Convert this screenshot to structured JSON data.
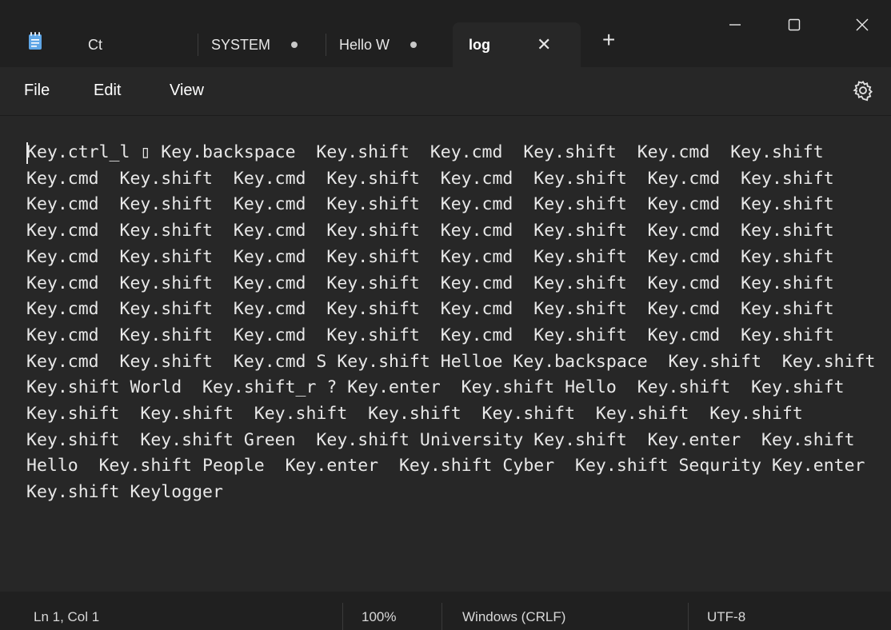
{
  "tabs": [
    {
      "label": "Ct",
      "modified": false,
      "active": false
    },
    {
      "label": "SYSTEM",
      "modified": true,
      "active": false
    },
    {
      "label": "Hello W",
      "modified": true,
      "active": false
    },
    {
      "label": "log",
      "modified": false,
      "active": true
    }
  ],
  "tab_close_glyph": "✕",
  "new_tab_glyph": "+",
  "menu": {
    "file": "File",
    "edit": "Edit",
    "view": "View"
  },
  "editor": {
    "content": "Key.ctrl_l ▯ Key.backspace  Key.shift  Key.cmd  Key.shift  Key.cmd  Key.shift  Key.cmd  Key.shift  Key.cmd  Key.shift  Key.cmd  Key.shift  Key.cmd  Key.shift  Key.cmd  Key.shift  Key.cmd  Key.shift  Key.cmd  Key.shift  Key.cmd  Key.shift  Key.cmd  Key.shift  Key.cmd  Key.shift  Key.cmd  Key.shift  Key.cmd  Key.shift  Key.cmd  Key.shift  Key.cmd  Key.shift  Key.cmd  Key.shift  Key.cmd  Key.shift  Key.cmd  Key.shift  Key.cmd  Key.shift  Key.cmd  Key.shift  Key.cmd  Key.shift  Key.cmd  Key.shift  Key.cmd  Key.shift  Key.cmd  Key.shift  Key.cmd  Key.shift  Key.cmd  Key.shift  Key.cmd  Key.shift  Key.cmd  Key.shift  Key.cmd  Key.shift  Key.cmd  Key.shift  Key.cmd S Key.shift Helloe Key.backspace  Key.shift  Key.shift  Key.shift World  Key.shift_r ? Key.enter  Key.shift Hello  Key.shift  Key.shift  Key.shift  Key.shift  Key.shift  Key.shift  Key.shift  Key.shift  Key.shift  Key.shift  Key.shift Green  Key.shift University Key.shift  Key.enter  Key.shift Hello  Key.shift People  Key.enter  Key.shift Cyber  Key.shift Sequrity Key.enter  Key.shift Keylogger"
  },
  "status": {
    "position": "Ln 1, Col 1",
    "zoom": "100%",
    "line_ending": "Windows (CRLF)",
    "encoding": "UTF-8"
  },
  "icons": {
    "app": "notepad-icon",
    "settings": "gear-icon",
    "minimize": "minimize-icon",
    "maximize": "maximize-icon",
    "close": "close-icon"
  },
  "colors": {
    "titlebar_bg": "#202020",
    "editor_bg": "#272727",
    "notepad_icon": "#5fa6e6"
  }
}
